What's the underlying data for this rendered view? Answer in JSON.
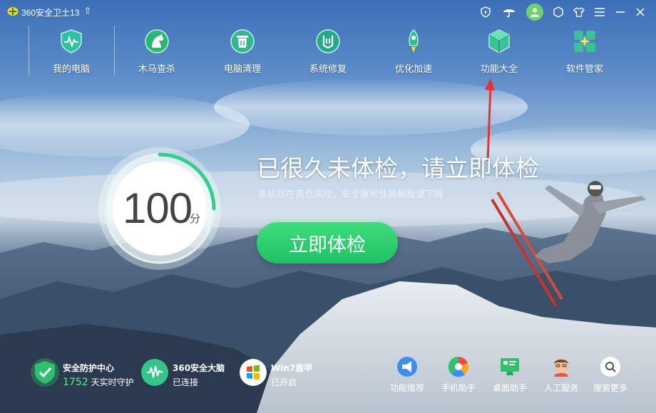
{
  "app": {
    "title": "360安全卫士13",
    "upgrade_icon": "arrow-up-icon"
  },
  "titlebar_icons": [
    "shield-bolt-icon",
    "umbrella-icon",
    "avatar-icon",
    "skin-icon",
    "shirt-icon",
    "menu-icon",
    "minimize-icon",
    "close-icon"
  ],
  "nav": {
    "items": [
      {
        "label": "我的电脑",
        "icon": "heartbeat-shield-icon"
      },
      {
        "label": "木马查杀",
        "icon": "horse-icon"
      },
      {
        "label": "电脑清理",
        "icon": "trash-icon"
      },
      {
        "label": "系统修复",
        "icon": "wrench-icon"
      },
      {
        "label": "优化加速",
        "icon": "rocket-icon"
      },
      {
        "label": "功能大全",
        "icon": "cube-icon"
      },
      {
        "label": "软件管家",
        "icon": "apps-icon"
      }
    ]
  },
  "score": {
    "value": "100",
    "unit": "分"
  },
  "headline": "已很久未体检，请立即体检",
  "subline": "系统存在高危风险，安全度和性能都极速下降",
  "check_button": "立即体检",
  "status": [
    {
      "title": "安全防护中心",
      "number": "1752",
      "sub": "天实时守护",
      "icon": "shield-check-icon"
    },
    {
      "title": "360安全大脑",
      "sub": "已连接",
      "icon": "brain-wave-icon"
    },
    {
      "title": "Win7盾甲",
      "sub": "已开启",
      "icon": "windows-logo-icon"
    }
  ],
  "tools": [
    {
      "label": "功能推荐",
      "icon": "megaphone-icon"
    },
    {
      "label": "手机助手",
      "icon": "phone-assistant-icon"
    },
    {
      "label": "桌面助手",
      "icon": "monitor-icon"
    },
    {
      "label": "人工服务",
      "icon": "service-person-icon"
    },
    {
      "label": "搜索更多",
      "icon": "search-icon"
    }
  ],
  "colors": {
    "accent_green": "#1fc267",
    "annotation_red": "#e8312f",
    "score_text": "#444444"
  }
}
